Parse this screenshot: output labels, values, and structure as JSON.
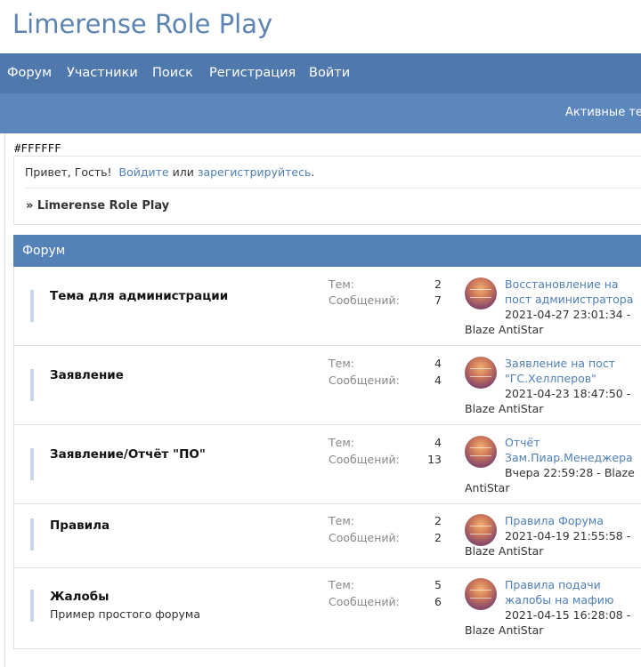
{
  "site": {
    "title": "Limerense Role Play"
  },
  "nav": {
    "items": [
      {
        "label": "Форум"
      },
      {
        "label": "Участники"
      },
      {
        "label": "Поиск"
      },
      {
        "label": "Регистрация"
      },
      {
        "label": "Войти"
      }
    ]
  },
  "subnav": {
    "active_topics": "Активные темы"
  },
  "code_text": "#FFFFFF",
  "greeting": {
    "prefix": "Привет, Гость!",
    "login": "Войдите",
    "or": "или",
    "register": "зарегистрируйтесь",
    "suffix": "."
  },
  "breadcrumb": "» Limerense Role Play",
  "forum": {
    "header": "Форум",
    "stat_labels": {
      "topics": "Тем:",
      "posts": "Сообщений:"
    },
    "rows": [
      {
        "title": "Тема для администрации",
        "description": "",
        "topics": "2",
        "posts": "7",
        "last_title": "Восстановление на пост администратора",
        "last_date": "2021-04-27 23:01:34 -",
        "last_author": "Blaze AntiStar"
      },
      {
        "title": "Заявление",
        "description": "",
        "topics": "4",
        "posts": "4",
        "last_title": "Заявление на пост \"ГС.Хеллперов\"",
        "last_date": "2021-04-23 18:47:50 -",
        "last_author": "Blaze AntiStar"
      },
      {
        "title": "Заявление/Отчёт \"ПО\"",
        "description": "",
        "topics": "4",
        "posts": "13",
        "last_title": "Отчёт Зам.Пиар.Менеджера",
        "last_date": "Вчера 22:59:28 - Blaze",
        "last_author": "AntiStar"
      },
      {
        "title": "Правила",
        "description": "",
        "topics": "2",
        "posts": "2",
        "last_title": "Правила Форума",
        "last_date": "2021-04-19 21:55:58 -",
        "last_author": "Blaze AntiStar"
      },
      {
        "title": "Жалобы",
        "description": "Пример простого форума",
        "topics": "5",
        "posts": "6",
        "last_title": "Правила подачи жалобы на мафию",
        "last_date": "2021-04-15 16:28:08 -",
        "last_author": "Blaze AntiStar"
      }
    ]
  }
}
